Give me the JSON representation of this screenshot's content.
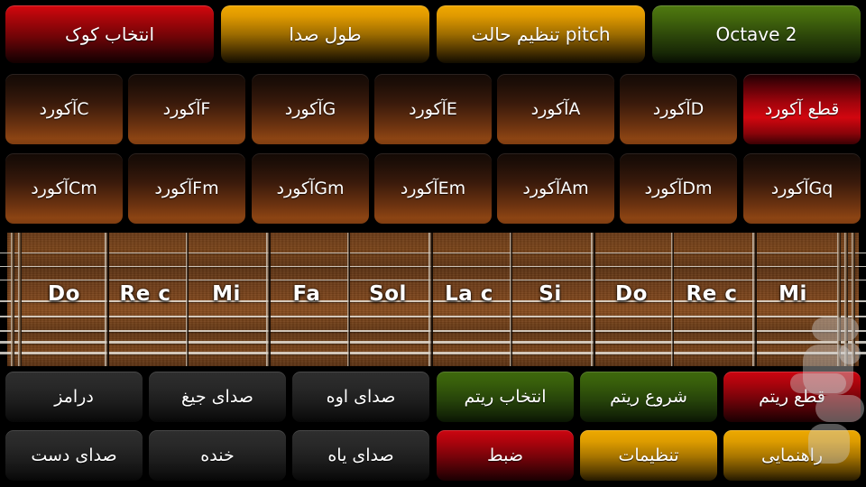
{
  "app": {
    "title": "Guitar / Chord Player",
    "background": "#000000"
  },
  "top_bar": {
    "buttons": [
      {
        "label": "انتخاب کوک",
        "name": "select-tuning-button",
        "style": "grad-red",
        "color": "#d6070d"
      },
      {
        "label": "طول صدا",
        "name": "sound-length-button",
        "style": "grad-gold",
        "color": "#f0a800"
      },
      {
        "label": "تنظیم حالت pitch",
        "name": "pitch-mode-button",
        "style": "grad-gold",
        "color": "#f0a800"
      },
      {
        "label": "Octave 2",
        "name": "octave-button",
        "style": "grad-green",
        "color": "#4f7a10"
      }
    ]
  },
  "chords": {
    "row1": [
      {
        "label": "آکوردC",
        "name": "chord-c-button",
        "style": "chord-btn"
      },
      {
        "label": "آکوردF",
        "name": "chord-f-button",
        "style": "chord-btn"
      },
      {
        "label": "آکوردG",
        "name": "chord-g-button",
        "style": "chord-btn"
      },
      {
        "label": "آکوردE",
        "name": "chord-e-button",
        "style": "chord-btn"
      },
      {
        "label": "آکوردA",
        "name": "chord-a-button",
        "style": "chord-btn"
      },
      {
        "label": "آکوردD",
        "name": "chord-d-button",
        "style": "chord-btn"
      },
      {
        "label": "قطع آکورد",
        "name": "stop-chord-button",
        "style": "chord-stop"
      }
    ],
    "row2": [
      {
        "label": "آکوردCm",
        "name": "chord-cm-button",
        "style": "chord-btn"
      },
      {
        "label": "آکوردFm",
        "name": "chord-fm-button",
        "style": "chord-btn"
      },
      {
        "label": "آکوردGm",
        "name": "chord-gm-button",
        "style": "chord-btn"
      },
      {
        "label": "آکوردEm",
        "name": "chord-em-button",
        "style": "chord-btn"
      },
      {
        "label": "آکوردAm",
        "name": "chord-am-button",
        "style": "chord-btn"
      },
      {
        "label": "آکوردDm",
        "name": "chord-dm-button",
        "style": "chord-btn"
      },
      {
        "label": "آکوردGq",
        "name": "chord-gq-button",
        "style": "chord-btn"
      }
    ]
  },
  "fretboard": {
    "note_labels": [
      "Do",
      "Re c",
      "Mi",
      "Fa",
      "Sol",
      "La c",
      "Si",
      "Do",
      "Re c",
      "Mi"
    ],
    "string_count": 6,
    "fret_count": 10,
    "wood_color": "#74401a",
    "string_color": "#e8e4dc"
  },
  "bottom_bar": {
    "row1": [
      {
        "label": "درامز",
        "name": "drums-button",
        "style": "dark-btn"
      },
      {
        "label": "صدای جیغ",
        "name": "scream-sound-button",
        "style": "dark-btn"
      },
      {
        "label": "صدای اوه",
        "name": "oh-sound-button",
        "style": "dark-btn"
      },
      {
        "label": "انتخاب ریتم",
        "name": "select-rhythm-button",
        "style": "green-btn"
      },
      {
        "label": "شروع ریتم",
        "name": "start-rhythm-button",
        "style": "green-btn"
      },
      {
        "label": "قطع ریتم",
        "name": "stop-rhythm-button",
        "style": "red-btn"
      }
    ],
    "row2": [
      {
        "label": "صدای دست",
        "name": "clap-sound-button",
        "style": "dark-btn"
      },
      {
        "label": "خنده",
        "name": "laugh-sound-button",
        "style": "dark-btn"
      },
      {
        "label": "صدای یاه",
        "name": "yeah-sound-button",
        "style": "dark-btn"
      },
      {
        "label": "ضبط",
        "name": "record-button",
        "style": "red-btn"
      },
      {
        "label": "تنظیمات",
        "name": "settings-button",
        "style": "gold-btn"
      },
      {
        "label": "راهنمایی",
        "name": "help-button",
        "style": "gold-btn"
      }
    ]
  }
}
